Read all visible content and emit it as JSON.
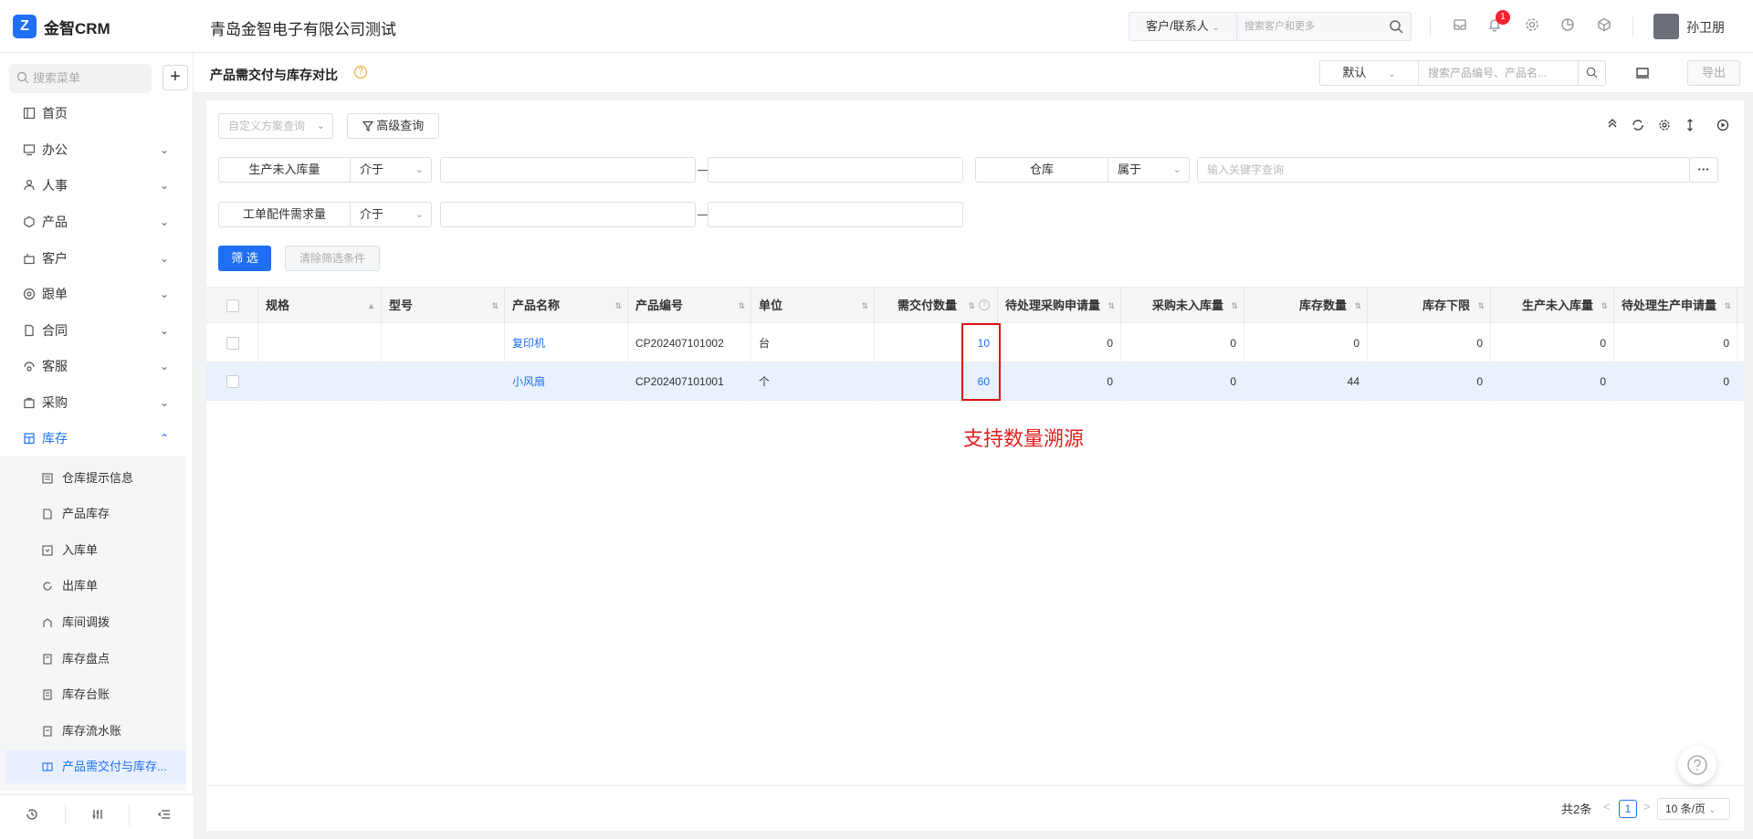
{
  "app": {
    "logo_text": "金智CRM",
    "company": "青岛金智电子有限公司测试"
  },
  "topbar": {
    "search_type": "客户/联系人",
    "search_placeholder": "搜索客户和更多",
    "notification_count": "1",
    "username": "孙卫朋"
  },
  "sidebar": {
    "search_placeholder": "搜索菜单",
    "plus": "+",
    "items": [
      {
        "label": "首页",
        "icon": "home-icon"
      },
      {
        "label": "办公",
        "icon": "office-icon",
        "chevron": "⌄"
      },
      {
        "label": "人事",
        "icon": "people-icon",
        "chevron": "⌄"
      },
      {
        "label": "产品",
        "icon": "cube-icon",
        "chevron": "⌄"
      },
      {
        "label": "客户",
        "icon": "customer-icon",
        "chevron": "⌄"
      },
      {
        "label": "跟单",
        "icon": "target-icon",
        "chevron": "⌄"
      },
      {
        "label": "合同",
        "icon": "contract-icon",
        "chevron": "⌄"
      },
      {
        "label": "客服",
        "icon": "service-icon",
        "chevron": "⌄"
      },
      {
        "label": "采购",
        "icon": "purchase-icon",
        "chevron": "⌄"
      },
      {
        "label": "库存",
        "icon": "warehouse-icon",
        "chevron": "⌃"
      }
    ],
    "subitems": [
      {
        "label": "仓库提示信息"
      },
      {
        "label": "产品库存"
      },
      {
        "label": "入库单"
      },
      {
        "label": "出库单"
      },
      {
        "label": "库间调拨"
      },
      {
        "label": "库存盘点"
      },
      {
        "label": "库存台账"
      },
      {
        "label": "库存流水账"
      },
      {
        "label": "产品需交付与库存..."
      }
    ]
  },
  "pagehead": {
    "title": "产品需交付与库存对比",
    "help": "?",
    "view_default": "默认",
    "search_placeholder": "搜索产品编号、产品名...",
    "export": "导出"
  },
  "filters": {
    "custom_scheme": "自定义方案查询",
    "advanced": "高级查询",
    "row1": {
      "field": "生产未入库量",
      "op": "介于",
      "field2": "仓库",
      "op2": "属于",
      "keyword_placeholder": "输入关键字查询",
      "more": "···"
    },
    "row2": {
      "field": "工单配件需求量",
      "op": "介于"
    },
    "filter_btn": "筛 选",
    "clear_btn": "清除筛选条件"
  },
  "table": {
    "headers": [
      "规格",
      "型号",
      "产品名称",
      "产品编号",
      "单位",
      "需交付数量",
      "待处理采购申请量",
      "采购未入库量",
      "库存数量",
      "库存下限",
      "生产未入库量",
      "待处理生产申请量"
    ],
    "rows": [
      {
        "spec": "",
        "model": "",
        "name": "复印机",
        "code": "CP202407101002",
        "unit": "台",
        "demand": "10",
        "pending_purchase": "0",
        "purchase_not_in": "0",
        "stock": "0",
        "stock_min": "0",
        "prod_not_in": "0",
        "pending_prod": "0"
      },
      {
        "spec": "",
        "model": "",
        "name": "小风扇",
        "code": "CP202407101001",
        "unit": "个",
        "demand": "60",
        "pending_purchase": "0",
        "purchase_not_in": "0",
        "stock": "44",
        "stock_min": "0",
        "prod_not_in": "0",
        "pending_prod": "0"
      }
    ]
  },
  "annotation": "支持数量溯源",
  "pager": {
    "total": "共2条",
    "prev": "<",
    "page": "1",
    "next": ">",
    "size": "10 条/页"
  },
  "colors": {
    "primary": "#1e6ff5",
    "annotation": "#e02020",
    "badge": "#f5222d"
  }
}
